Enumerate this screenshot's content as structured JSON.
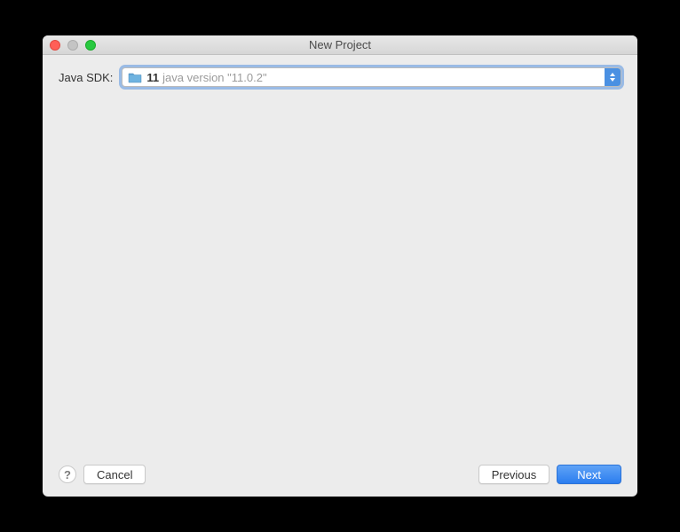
{
  "window": {
    "title": "New Project"
  },
  "form": {
    "sdk_label": "Java SDK:",
    "sdk_selected_name": "11",
    "sdk_selected_version": "java version \"11.0.2\""
  },
  "footer": {
    "help_symbol": "?",
    "cancel_label": "Cancel",
    "previous_label": "Previous",
    "next_label": "Next"
  }
}
